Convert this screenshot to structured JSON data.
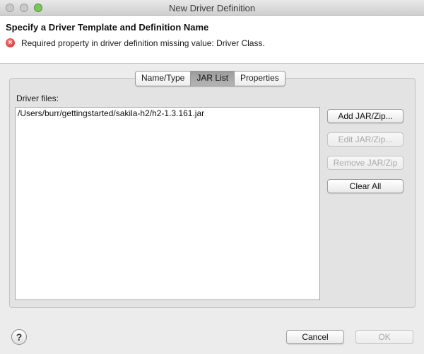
{
  "window": {
    "title": "New Driver Definition"
  },
  "banner": {
    "title": "Specify a Driver Template and Definition Name",
    "error_icon": "error-circle-x-icon",
    "error_message": "Required property in driver definition missing value: Driver Class."
  },
  "tabs": [
    {
      "label": "Name/Type",
      "active": false
    },
    {
      "label": "JAR List",
      "active": true
    },
    {
      "label": "Properties",
      "active": false
    }
  ],
  "jar_list": {
    "label": "Driver files:",
    "items": [
      "/Users/burr/gettingstarted/sakila-h2/h2-1.3.161.jar"
    ],
    "buttons": {
      "add": {
        "label": "Add JAR/Zip...",
        "enabled": true
      },
      "edit": {
        "label": "Edit JAR/Zip...",
        "enabled": false
      },
      "remove": {
        "label": "Remove JAR/Zip",
        "enabled": false
      },
      "clear": {
        "label": "Clear All",
        "enabled": true
      }
    }
  },
  "footer": {
    "help_icon": "help-question-icon",
    "help_glyph": "?",
    "cancel_label": "Cancel",
    "ok_label": "OK",
    "ok_enabled": false
  }
}
